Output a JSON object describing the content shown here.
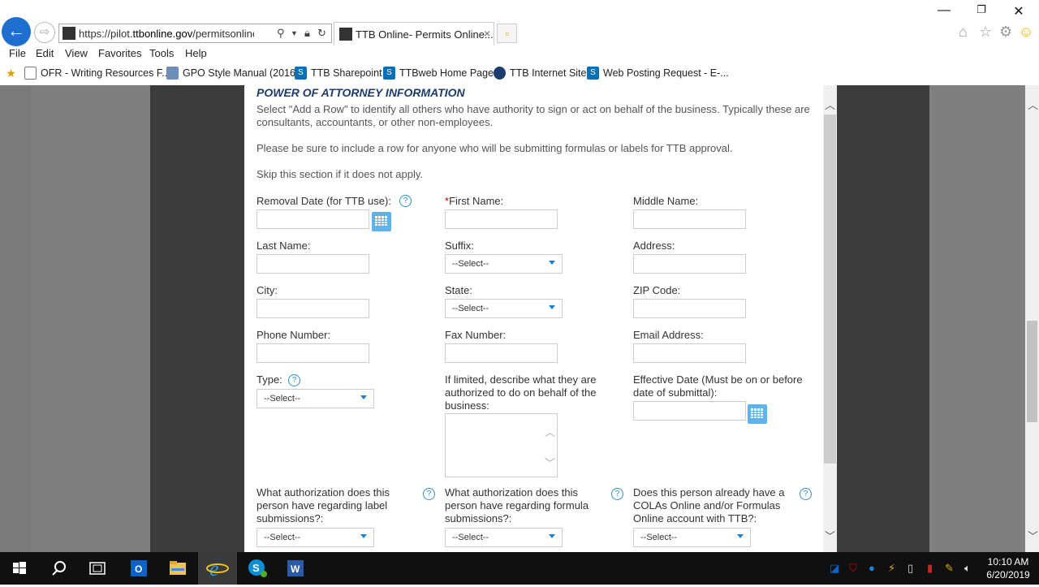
{
  "browser": {
    "address_url_prefix": "https://pilot.",
    "address_url_domain": "ttbonline.gov",
    "address_url_rest": "/permitsonline/Def...",
    "tab_title": "TTB Online- Permits Online...",
    "tab_favicon": "EAP 6"
  },
  "menu": [
    "File",
    "Edit",
    "View",
    "Favorites",
    "Tools",
    "Help"
  ],
  "favorites": [
    {
      "label": "OFR - Writing Resources F...",
      "icon": "document-icon"
    },
    {
      "label": "GPO Style Manual (2016)",
      "icon": "gpo-icon"
    },
    {
      "label": "TTB Sharepoint",
      "icon": "sharepoint-icon"
    },
    {
      "label": "TTBweb Home Page",
      "icon": "sharepoint-icon"
    },
    {
      "label": "TTB Internet Site",
      "icon": "ttb-seal-icon"
    },
    {
      "label": "Web Posting Request - E-...",
      "icon": "sharepoint-icon"
    }
  ],
  "form": {
    "section_title": "POWER OF ATTORNEY INFORMATION",
    "intro": "Select \"Add a Row\" to identify all others who have authority to sign or act on behalf of the business. Typically these are consultants, accountants, or other non-employees.",
    "note": "Please be sure to include a row for anyone who will be submitting formulas or labels for TTB approval.",
    "skip": "Skip this section if it does not apply.",
    "removal_date": "Removal Date (for TTB use):",
    "first_name": "First Name:",
    "middle_name": "Middle Name:",
    "last_name": "Last Name:",
    "suffix": "Suffix:",
    "address": "Address:",
    "city": "City:",
    "state": "State:",
    "zip": "ZIP Code:",
    "phone": "Phone Number:",
    "fax": "Fax Number:",
    "email": "Email Address:",
    "type": "Type:",
    "limited": "If limited, describe what they are authorized to do on behalf of the business:",
    "effective_date": "Effective Date (Must be on or before date of submittal):",
    "label_auth": "What authorization does this person have regarding label submissions?:",
    "formula_auth": "What authorization does this person have regarding formula submissions?:",
    "colas": "Does this person already have a COLAs Online and/or Formulas Online account with TTB?:",
    "select_placeholder": "--Select--",
    "required_mark": "*",
    "help_glyph": "?"
  },
  "taskbar": {
    "time": "10:10 AM",
    "date": "6/20/2019",
    "apps": [
      "windows-start-icon",
      "search-icon",
      "task-view-icon",
      "outlook-icon",
      "file-explorer-icon",
      "internet-explorer-icon",
      "skype-icon",
      "word-icon"
    ]
  }
}
